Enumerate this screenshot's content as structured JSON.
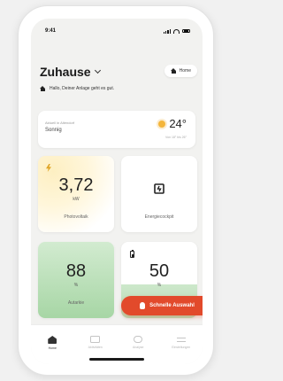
{
  "status_bar": {
    "time": "9:41"
  },
  "header": {
    "title": "Zuhause",
    "home_pill_label": "Home",
    "greeting": "Hallo, Deiner Anlage geht es gut."
  },
  "weather": {
    "label": "Aktuell in Altendorf",
    "condition": "Sonnig",
    "temperature": "24°",
    "range": "Von 18° bis 26°"
  },
  "tiles": {
    "photovoltaik": {
      "value": "3,72",
      "unit": "kW",
      "label": "Photovoltaik"
    },
    "energiecockpit": {
      "label": "Energiecockpit"
    },
    "autarkie": {
      "value": "88",
      "unit": "%",
      "label": "Autarkie",
      "level_percent": 88
    },
    "battery": {
      "value": "50",
      "unit": "%",
      "level_percent": 50
    }
  },
  "fab": {
    "label": "Schnelle Auswahl"
  },
  "tabbar": {
    "items": [
      {
        "label": "Home",
        "icon": "home-icon"
      },
      {
        "label": "Aktivitäten",
        "icon": "screen-icon"
      },
      {
        "label": "Analyse",
        "icon": "chart-icon"
      },
      {
        "label": "Einstellungen",
        "icon": "sliders-icon"
      }
    ]
  },
  "colors": {
    "accent": "#e24a2b",
    "solar": "#e0a526",
    "green_tile": "#a7d6a5",
    "background": "#f2f2f0"
  }
}
